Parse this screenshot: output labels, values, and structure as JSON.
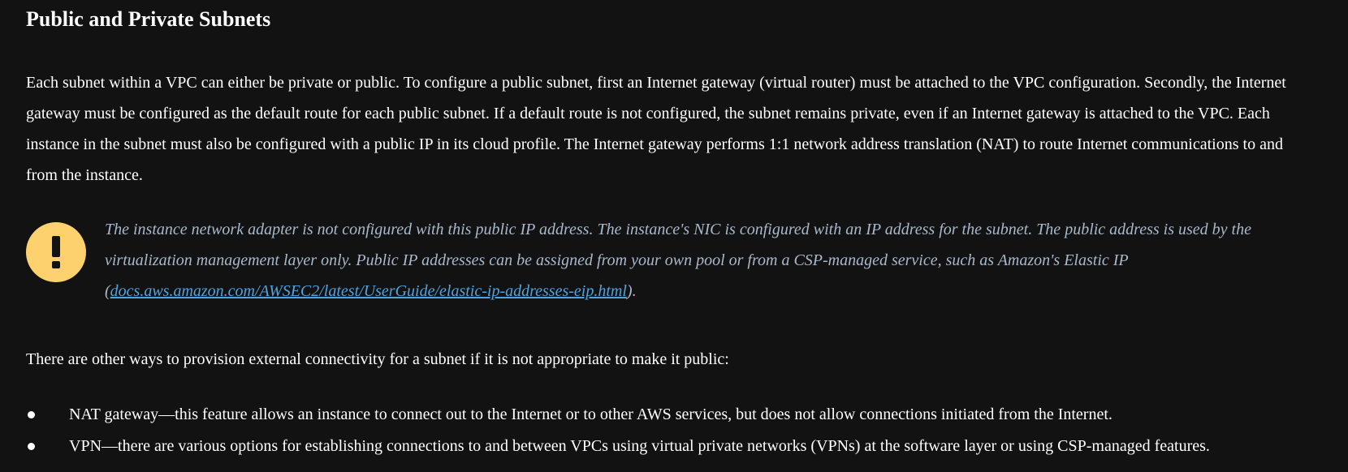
{
  "section": {
    "title": "Public and Private Subnets"
  },
  "paragraph_1": "Each subnet within a VPC can either be private or public. To configure a public subnet, first an Internet gateway (virtual router) must be attached to the VPC configuration. Secondly, the Internet gateway must be configured as the default route for each public subnet. If a default route is not configured, the subnet remains private, even if an Internet gateway is attached to the VPC. Each instance in the subnet must also be configured with a public IP in its cloud profile. The Internet gateway performs 1:1 network address translation (NAT) to route Internet communications to and from the instance.",
  "note": {
    "icon": "exclamation-icon",
    "icon_color": "#fdd26e",
    "text_before_link": "The instance network adapter is not configured with this public IP address. The instance's NIC is configured with an IP address for the subnet. The public address is used by the virtualization management layer only. Public IP addresses can be assigned from your own pool or from a CSP-managed service, such as Amazon's Elastic IP (",
    "link_text": "docs.aws.amazon.com/AWSEC2/latest/UserGuide/elastic-ip-addresses-eip.html",
    "text_after_link": ").",
    "text_color": "#a9b9cc",
    "link_color": "#4ea3e0"
  },
  "paragraph_2": "There are other ways to provision external connectivity for a subnet if it is not appropriate to make it public:",
  "bullets": [
    "NAT gateway—this feature allows an instance to connect out to the Internet or to other AWS services, but does not allow connections initiated from the Internet.",
    "VPN—there are various options for establishing connections to and between VPCs using virtual private networks (VPNs) at the software layer or using CSP-managed features."
  ],
  "colors": {
    "background": "#121212",
    "text": "#ffffff"
  }
}
